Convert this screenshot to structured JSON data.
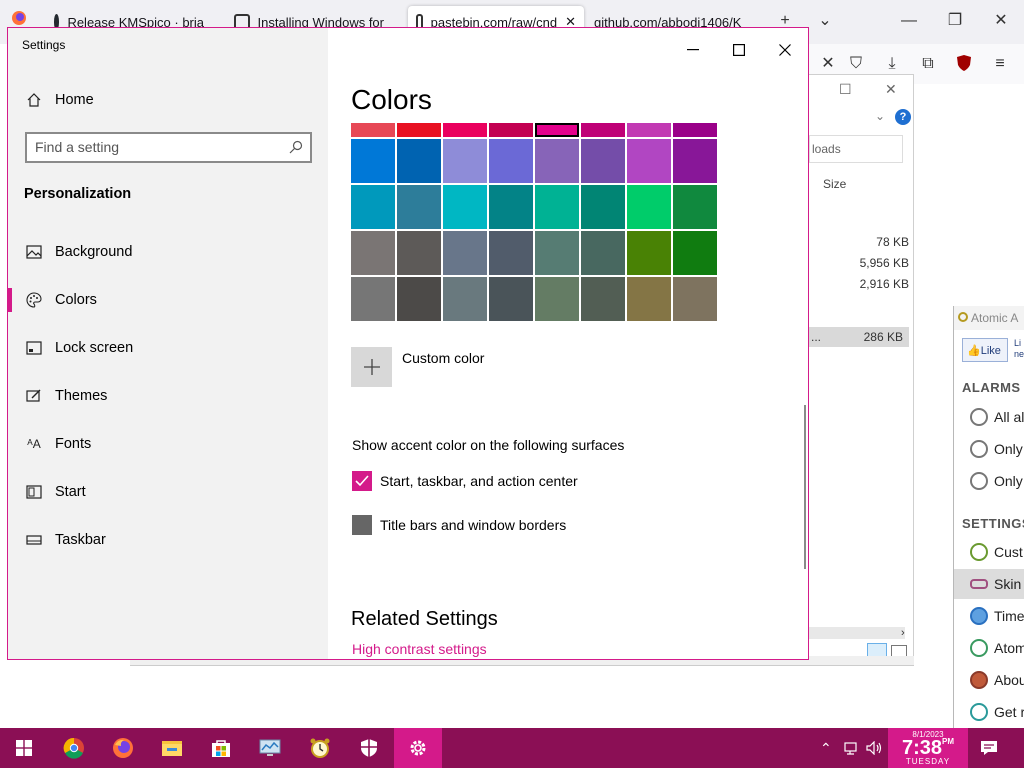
{
  "browser": {
    "tabs": [
      {
        "label": "Release KMSpico · bria",
        "icon": "github-icon"
      },
      {
        "label": "Installing Windows for",
        "icon": "page-icon"
      },
      {
        "label": "pastebin.com/raw/cnd",
        "icon": "pastebin-icon",
        "active": true
      },
      {
        "label": "github.com/abbodi1406/K",
        "icon": "github-icon"
      }
    ],
    "new_tab": "+",
    "tab_list": "⌄"
  },
  "explorer": {
    "search_placeholder": "loads",
    "size_header": "Size",
    "files": [
      {
        "size": "78 KB"
      },
      {
        "size": "5,956 KB"
      },
      {
        "size": "2,916 KB"
      },
      {
        "name": "...",
        "size": "286 KB"
      }
    ]
  },
  "atomic": {
    "title": "Atomic A",
    "like": "Like",
    "like_extra": "Li ne",
    "sections": {
      "alarms": "ALARMS",
      "settings": "SETTINGS"
    },
    "alarm_items": [
      "All al",
      "Only",
      "Only"
    ],
    "settings_items": [
      "Cust",
      "Skin",
      "Time",
      "Atom",
      "Abou",
      "Get r"
    ]
  },
  "settings": {
    "window_title": "Settings",
    "home": "Home",
    "search_placeholder": "Find a setting",
    "section": "Personalization",
    "nav": [
      {
        "label": "Background",
        "icon": "picture-icon"
      },
      {
        "label": "Colors",
        "icon": "palette-icon",
        "active": true
      },
      {
        "label": "Lock screen",
        "icon": "lock-screen-icon"
      },
      {
        "label": "Themes",
        "icon": "themes-icon"
      },
      {
        "label": "Fonts",
        "icon": "fonts-icon"
      },
      {
        "label": "Start",
        "icon": "start-icon"
      },
      {
        "label": "Taskbar",
        "icon": "taskbar-icon"
      }
    ],
    "page_title": "Colors",
    "accent_colors": [
      [
        "#e74856",
        "#e81123",
        "#ea005e",
        "#c30052",
        "#e3008c",
        "#bf0077",
        "#c239b3",
        "#9a0089"
      ],
      [
        "#0078d7",
        "#0063b1",
        "#8e8cd8",
        "#6b69d6",
        "#8764b8",
        "#744da9",
        "#b146c2",
        "#881798"
      ],
      [
        "#0099bc",
        "#2d7d9a",
        "#00b7c3",
        "#038387",
        "#00b294",
        "#018574",
        "#00cc6a",
        "#10893e"
      ],
      [
        "#7a7574",
        "#5d5a58",
        "#68768a",
        "#515c6b",
        "#567c73",
        "#486860",
        "#498205",
        "#107c10"
      ],
      [
        "#767676",
        "#4c4a48",
        "#69797e",
        "#4a5459",
        "#647c64",
        "#525e54",
        "#847545",
        "#7e735f"
      ]
    ],
    "selected_color": "#e3008c",
    "custom_color": "Custom color",
    "surfaces_label": "Show accent color on the following surfaces",
    "surfaces": [
      {
        "label": "Start, taskbar, and action center",
        "checked": true
      },
      {
        "label": "Title bars and window borders",
        "checked": false
      }
    ],
    "related_heading": "Related Settings",
    "high_contrast_link": "High contrast settings",
    "accent": "#d41a8a"
  },
  "taskbar": {
    "apps": [
      "windows-start-icon",
      "chrome-icon",
      "firefox-icon",
      "file-explorer-icon",
      "store-icon",
      "monitor-icon",
      "alarm-clock-icon",
      "defender-icon",
      "settings-icon"
    ],
    "clock": {
      "date": "8/1/2023",
      "time": "7:38",
      "period": "PM",
      "day": "TUESDAY"
    },
    "color": "#8b0f55"
  }
}
